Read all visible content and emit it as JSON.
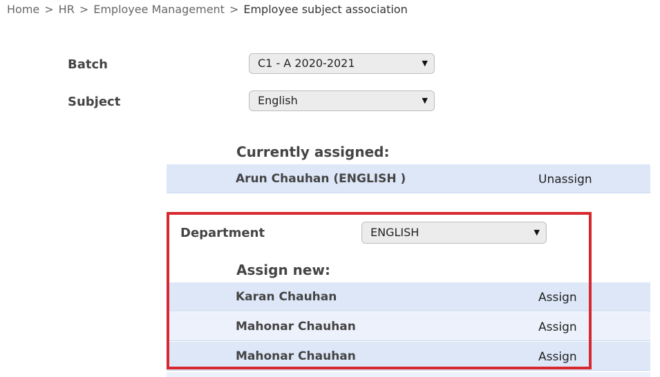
{
  "breadcrumb": {
    "items": [
      "Home",
      "HR",
      "Employee Management"
    ],
    "separator": ">",
    "current": "Employee subject association"
  },
  "form": {
    "batch_label": "Batch",
    "batch_value": "C1 - A 2020-2021",
    "subject_label": "Subject",
    "subject_value": "English"
  },
  "currently_assigned": {
    "title": "Currently assigned:",
    "items": [
      {
        "name": "Arun Chauhan (ENGLISH )",
        "action": "Unassign"
      }
    ]
  },
  "department": {
    "label": "Department",
    "value": "ENGLISH"
  },
  "assign_new": {
    "title": "Assign new:",
    "items": [
      {
        "name": "Karan Chauhan",
        "action": "Assign"
      },
      {
        "name": "Mahonar Chauhan",
        "action": "Assign"
      },
      {
        "name": "Mahonar Chauhan",
        "action": "Assign"
      }
    ]
  },
  "icons": {
    "dropdown_caret": "▼"
  },
  "colors": {
    "row_primary": "#dde7f8",
    "row_alternate": "#ecf1fb",
    "highlight_border": "#d7272f"
  }
}
